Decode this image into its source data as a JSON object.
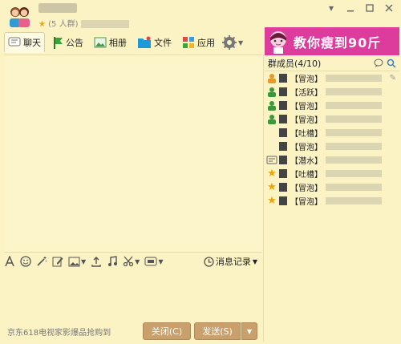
{
  "header": {
    "member_count_text": "(5   人群)"
  },
  "tabs": [
    {
      "label": "聊天",
      "icon": "chat-icon"
    },
    {
      "label": "公告",
      "icon": "flag-icon"
    },
    {
      "label": "相册",
      "icon": "album-icon"
    },
    {
      "label": "文件",
      "icon": "folder-icon"
    },
    {
      "label": "应用",
      "icon": "apps-icon"
    }
  ],
  "banner": {
    "text": "教你瘦到90斤",
    "color": "#dd3c9c"
  },
  "members": {
    "title": "群成员(4/10)",
    "list": [
      {
        "tag": "【冒泡】"
      },
      {
        "tag": "【活跃】"
      },
      {
        "tag": "【冒泡】"
      },
      {
        "tag": "【冒泡】"
      },
      {
        "tag": "【吐槽】"
      },
      {
        "tag": "【冒泡】"
      },
      {
        "tag": "【潜水】"
      },
      {
        "tag": "【吐槽】"
      },
      {
        "tag": "【冒泡】"
      },
      {
        "tag": "【冒泡】"
      }
    ]
  },
  "toolbar": {
    "history_label": "消息记录"
  },
  "bottom": {
    "ad_text": "京东618电视家影爆品抢购到",
    "close_label": "关闭(C)",
    "send_label": "发送(S)"
  }
}
